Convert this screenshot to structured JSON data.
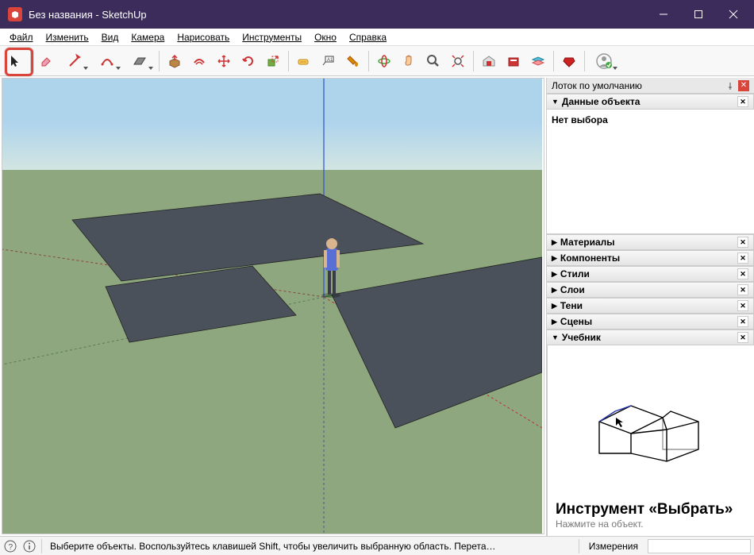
{
  "title": "Без названия - SketchUp",
  "menu": [
    "Файл",
    "Изменить",
    "Вид",
    "Камера",
    "Нарисовать",
    "Инструменты",
    "Окно",
    "Справка"
  ],
  "tray": {
    "default_tray": "Лоток по умолчанию",
    "entity_info": {
      "title": "Данные объекта",
      "body": "Нет выбора"
    },
    "panels": [
      "Материалы",
      "Компоненты",
      "Стили",
      "Слои",
      "Тени",
      "Сцены"
    ],
    "tutorial": {
      "header": "Учебник",
      "title": "Инструмент «Выбрать»",
      "sub": "Нажмите на объект."
    }
  },
  "status": {
    "hint": "Выберите объекты. Воспользуйтесь клавишей Shift, чтобы увеличить выбранную область. Перета…",
    "measurements_label": "Измерения"
  }
}
